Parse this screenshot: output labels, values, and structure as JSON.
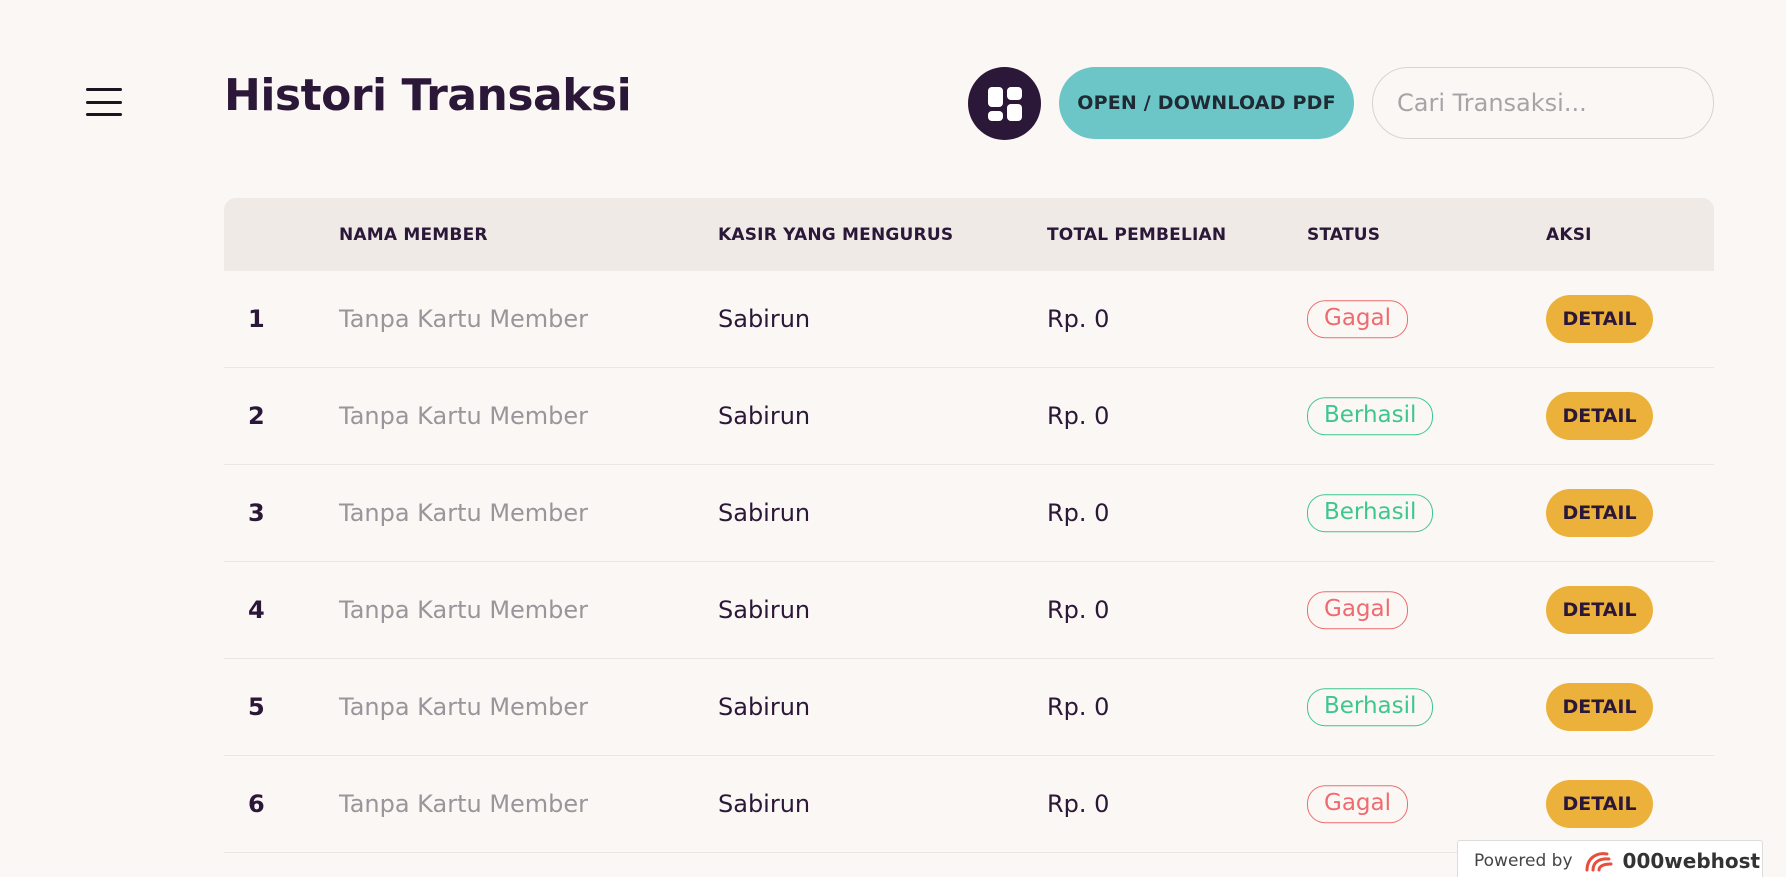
{
  "header": {
    "title": "Histori Transaksi",
    "pdf_button": "OPEN / DOWNLOAD PDF",
    "search_placeholder": "Cari Transaksi..."
  },
  "table": {
    "columns": [
      "NAMA MEMBER",
      "KASIR YANG MENGURUS",
      "TOTAL PEMBELIAN",
      "STATUS",
      "AKSI"
    ],
    "rows": [
      {
        "no": "1",
        "member": "Tanpa Kartu Member",
        "kasir": "Sabirun",
        "total": "Rp. 0",
        "status": "Gagal",
        "action": "DETAIL"
      },
      {
        "no": "2",
        "member": "Tanpa Kartu Member",
        "kasir": "Sabirun",
        "total": "Rp. 0",
        "status": "Berhasil",
        "action": "DETAIL"
      },
      {
        "no": "3",
        "member": "Tanpa Kartu Member",
        "kasir": "Sabirun",
        "total": "Rp. 0",
        "status": "Berhasil",
        "action": "DETAIL"
      },
      {
        "no": "4",
        "member": "Tanpa Kartu Member",
        "kasir": "Sabirun",
        "total": "Rp. 0",
        "status": "Gagal",
        "action": "DETAIL"
      },
      {
        "no": "5",
        "member": "Tanpa Kartu Member",
        "kasir": "Sabirun",
        "total": "Rp. 0",
        "status": "Berhasil",
        "action": "DETAIL"
      },
      {
        "no": "6",
        "member": "Tanpa Kartu Member",
        "kasir": "Sabirun",
        "total": "Rp. 0",
        "status": "Gagal",
        "action": "DETAIL"
      }
    ]
  },
  "footer_badge": {
    "powered_by": "Powered by",
    "brand": "000webhost"
  },
  "colors": {
    "background": "#fbf7f4",
    "primary_dark": "#2b1737",
    "teal": "#6cc6c8",
    "detail_yellow": "#ecb13b",
    "success": "#3dc78d",
    "failure": "#ee6b6f"
  },
  "icons": {
    "menu": "hamburger-menu-icon",
    "grid": "dashboard-grid-icon",
    "logo": "000webhost-logo-icon"
  }
}
